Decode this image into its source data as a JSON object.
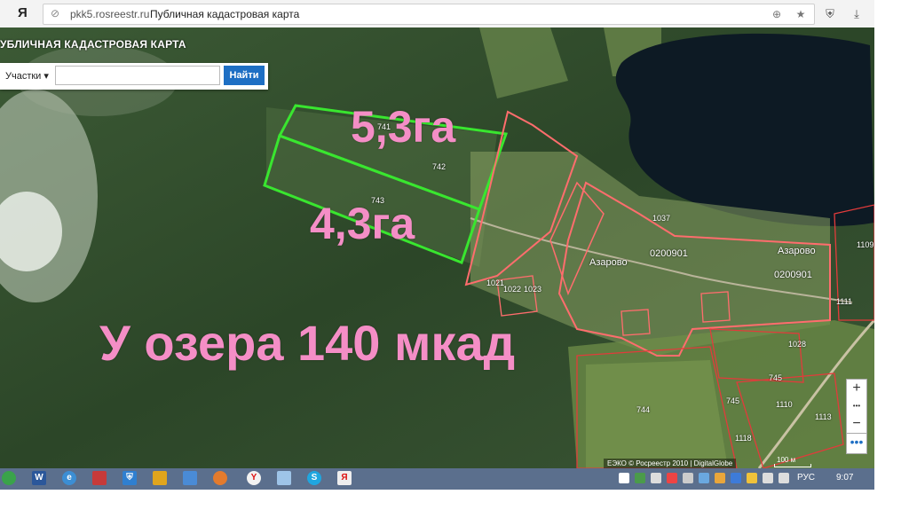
{
  "browser": {
    "logo": "Я",
    "domain": "pkk5.rosreestr.ru",
    "page_title": "Публичная кадастровая карта"
  },
  "app": {
    "title": "УБЛИЧНАЯ КАДАСТРОВАЯ КАРТА",
    "search_type": "Участки ▾",
    "search_placeholder": "",
    "search_button": "Найти"
  },
  "annotations": {
    "area_1": "5,3га",
    "area_2": "4,3га",
    "headline": "У озера 140 мкад"
  },
  "parcels": {
    "p741": "741",
    "p742": "742",
    "p743": "743",
    "p1037": "1037",
    "p1028": "1028",
    "p745a": "745",
    "p745b": "745",
    "p744": "744",
    "p1110": "1110",
    "p1111": "1111",
    "p1113": "1113",
    "p1109": "1109",
    "p1118": "1118",
    "p1021": "1021",
    "p1022": "1022",
    "p1023": "1023"
  },
  "villages": {
    "v1_name": "Азарово",
    "v1_code": "0200901",
    "v2_name": "Азарово",
    "v2_code": "0200901"
  },
  "map_controls": {
    "zoom_in": "+",
    "zoom_dots": "•••",
    "zoom_out": "−",
    "more": "•••",
    "attribution": "ЕЭКО © Росреестр 2010 | DigitalGlobe",
    "scale_label": "100 м"
  },
  "taskbar": {
    "lang": "РУС",
    "time": "9:07"
  },
  "colors": {
    "browser_bar": "#f3f3f3",
    "search_button": "#1e6fc4",
    "annotation_pink": "#f48ec6",
    "parcel_green": "#39e62f",
    "parcel_red": "#e23b3b",
    "taskbar": "#5b6f8d"
  }
}
